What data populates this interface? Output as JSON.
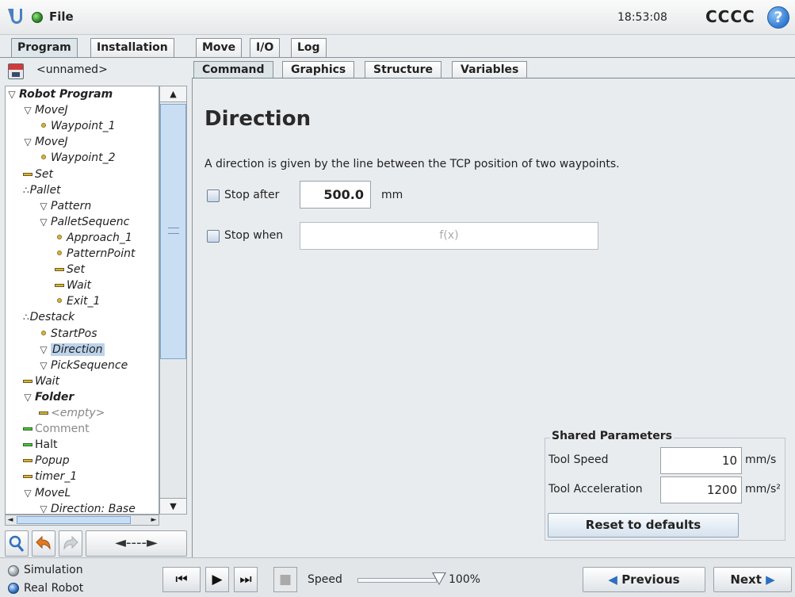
{
  "titlebar": {
    "file_label": "File",
    "clock": "18:53:08",
    "robot_name": "CCCC",
    "help_glyph": "?"
  },
  "main_tabs": [
    {
      "label": "Program"
    },
    {
      "label": "Installation"
    },
    {
      "label": "Move"
    },
    {
      "label": "I/O"
    },
    {
      "label": "Log"
    }
  ],
  "left": {
    "program_name": "<unnamed>",
    "tree": [
      {
        "label": "Robot Program",
        "icon": "triangle-down",
        "bold": true
      },
      {
        "label": "MoveJ",
        "icon": "triangle-down"
      },
      {
        "label": "Waypoint_1",
        "icon": "waypoint"
      },
      {
        "label": "MoveJ",
        "icon": "triangle-down"
      },
      {
        "label": "Waypoint_2",
        "icon": "waypoint"
      },
      {
        "label": "Set",
        "icon": "bar"
      },
      {
        "label": "Pallet",
        "icon": "dots"
      },
      {
        "label": "Pattern",
        "icon": "triangle-down"
      },
      {
        "label": "PalletSequenc",
        "icon": "triangle-down"
      },
      {
        "label": "Approach_1",
        "icon": "waypoint"
      },
      {
        "label": "PatternPoint",
        "icon": "waypoint"
      },
      {
        "label": "Set",
        "icon": "bar"
      },
      {
        "label": "Wait",
        "icon": "bar"
      },
      {
        "label": "Exit_1",
        "icon": "waypoint"
      },
      {
        "label": "Destack",
        "icon": "dots"
      },
      {
        "label": "StartPos",
        "icon": "waypoint"
      },
      {
        "label": "Direction",
        "icon": "triangle-down",
        "selected": true
      },
      {
        "label": "PickSequence",
        "icon": "triangle-down"
      },
      {
        "label": "Wait",
        "icon": "bar"
      },
      {
        "label": "Folder",
        "icon": "triangle-down",
        "bold": true
      },
      {
        "label": "<empty>",
        "icon": "bar",
        "grey": true
      },
      {
        "label": "Comment",
        "icon": "bar-green",
        "grey": true,
        "plain": true
      },
      {
        "label": "Halt",
        "icon": "bar-green",
        "plain": true
      },
      {
        "label": "Popup",
        "icon": "bar"
      },
      {
        "label": "timer_1",
        "icon": "bar"
      },
      {
        "label": "MoveL",
        "icon": "triangle-down"
      },
      {
        "label": "Direction: Base",
        "icon": "triangle-down"
      }
    ],
    "move_arrows": "◄----►"
  },
  "content_tabs": [
    {
      "label": "Command"
    },
    {
      "label": "Graphics"
    },
    {
      "label": "Structure"
    },
    {
      "label": "Variables"
    }
  ],
  "command": {
    "title": "Direction",
    "description": "A direction is given by the line between the TCP position of two waypoints.",
    "stop_after_label": "Stop after",
    "stop_after_value": "500.0",
    "stop_after_unit": "mm",
    "stop_when_label": "Stop when",
    "stop_when_placeholder": "f(x)"
  },
  "shared": {
    "title": "Shared Parameters",
    "speed_label": "Tool Speed",
    "speed_value": "10",
    "speed_unit": "mm/s",
    "accel_label": "Tool Acceleration",
    "accel_value": "1200",
    "accel_unit": "mm/s²",
    "reset_label": "Reset to defaults"
  },
  "bottom": {
    "simulation_label": "Simulation",
    "real_robot_label": "Real Robot",
    "speed_label": "Speed",
    "speed_value": "100%",
    "speed_fraction": 1.0,
    "previous_label": "Previous",
    "next_label": "Next"
  },
  "colors": {
    "accent_blue": "#2f6fbf",
    "waypoint_yellow": "#d9b53b",
    "selection": "#bcd3ea"
  }
}
